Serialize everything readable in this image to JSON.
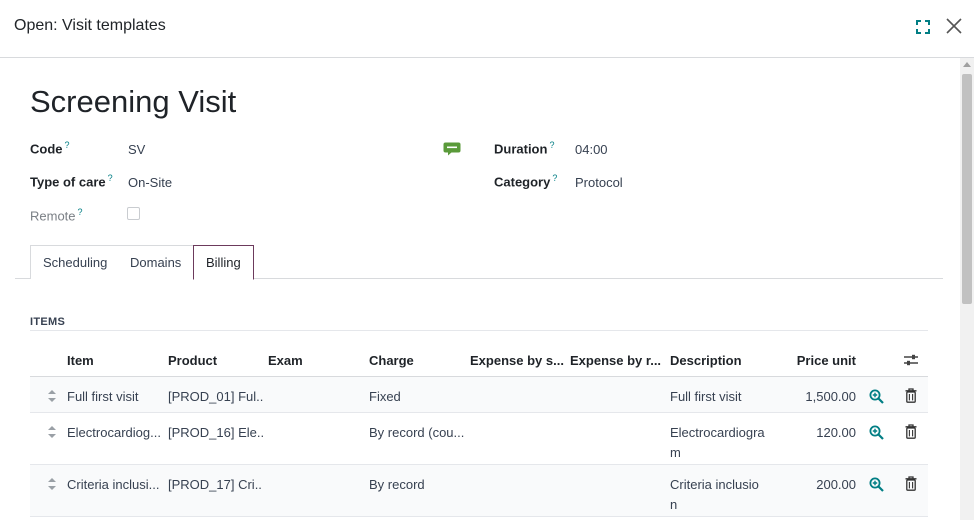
{
  "dialog": {
    "title": "Open: Visit templates"
  },
  "record": {
    "title": "Screening Visit"
  },
  "fields": {
    "code": {
      "label": "Code",
      "help": "?",
      "value": "SV"
    },
    "type_of_care": {
      "label": "Type of care",
      "help": "?",
      "value": "On-Site"
    },
    "remote": {
      "label": "Remote",
      "help": "?"
    },
    "duration": {
      "label": "Duration",
      "help": "?",
      "value": "04:00"
    },
    "category": {
      "label": "Category",
      "help": "?",
      "value": "Protocol"
    }
  },
  "tabs": [
    {
      "label": "Scheduling"
    },
    {
      "label": "Domains"
    },
    {
      "label": "Billing",
      "active": true
    }
  ],
  "items_section": {
    "title": "ITEMS",
    "columns": [
      "Item",
      "Product",
      "Exam",
      "Charge",
      "Expense by s...",
      "Expense by r...",
      "Description",
      "Price unit"
    ],
    "rows": [
      {
        "item": "Full first visit",
        "product": "[PROD_01] Ful...",
        "exam": "",
        "charge": "Fixed",
        "expense_s": "",
        "expense_r": "",
        "description": "Full first visit",
        "price": "1,500.00"
      },
      {
        "item": "Electrocardiog...",
        "product": "[PROD_16] Ele...",
        "exam": "",
        "charge": "By record (cou...",
        "expense_s": "",
        "expense_r": "",
        "description": "Electrocardiogram",
        "price": "120.00"
      },
      {
        "item": "Criteria inclusi...",
        "product": "[PROD_17] Cri...",
        "exam": "",
        "charge": "By record",
        "expense_s": "",
        "expense_r": "",
        "description": "Criteria inclusion",
        "price": "200.00"
      }
    ]
  },
  "colors": {
    "accent": "#6c3a5c",
    "teal": "#017e84",
    "green": "#5a9a3a"
  },
  "icons": [
    "expand-icon",
    "close-icon",
    "chat-icon",
    "settings-icon",
    "drag-handle-icon",
    "zoom-icon",
    "trash-icon"
  ]
}
